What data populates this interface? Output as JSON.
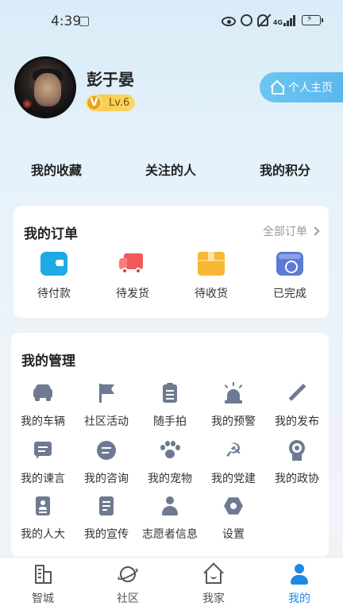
{
  "status_bar": {
    "time": "4:39",
    "network": "4G"
  },
  "profile": {
    "username": "彭于晏",
    "level_badge_letter": "V",
    "level": "Lv.6",
    "home_button_label": "个人主页"
  },
  "quick_links": [
    "我的收藏",
    "关注的人",
    "我的积分"
  ],
  "orders": {
    "title": "我的订单",
    "all_label": "全部订单",
    "items": [
      {
        "label": "待付款",
        "icon": "wallet-icon",
        "color": "#1fa9e5"
      },
      {
        "label": "待发货",
        "icon": "truck-icon",
        "color": "#f05a5a"
      },
      {
        "label": "待收货",
        "icon": "box-icon",
        "color": "#f7b733"
      },
      {
        "label": "已完成",
        "icon": "completed-icon",
        "color": "#5a7bd6"
      }
    ]
  },
  "management": {
    "title": "我的管理",
    "items": [
      {
        "label": "我的车辆",
        "icon": "car-icon"
      },
      {
        "label": "社区活动",
        "icon": "flag-icon"
      },
      {
        "label": "随手拍",
        "icon": "clipboard-icon"
      },
      {
        "label": "我的预警",
        "icon": "siren-icon"
      },
      {
        "label": "我的发布",
        "icon": "pencil-icon"
      },
      {
        "label": "我的谏言",
        "icon": "message-icon"
      },
      {
        "label": "我的咨询",
        "icon": "chat-bubble-icon"
      },
      {
        "label": "我的宠物",
        "icon": "paw-icon"
      },
      {
        "label": "我的党建",
        "icon": "party-emblem-icon"
      },
      {
        "label": "我的政协",
        "icon": "medal-icon"
      },
      {
        "label": "我的人大",
        "icon": "id-badge-icon"
      },
      {
        "label": "我的宣传",
        "icon": "document-icon"
      },
      {
        "label": "志愿者信息",
        "icon": "person-icon"
      },
      {
        "label": "设置",
        "icon": "settings-hex-icon"
      }
    ],
    "icon_color": "#6e7a91"
  },
  "bottom_nav": {
    "items": [
      {
        "label": "智城",
        "icon": "city-icon"
      },
      {
        "label": "社区",
        "icon": "planet-icon"
      },
      {
        "label": "我家",
        "icon": "house-icon"
      },
      {
        "label": "我的",
        "icon": "user-icon",
        "active": true
      }
    ],
    "active_color": "#1e88e5"
  },
  "colors": {
    "accent": "#5ab7ee",
    "badge_gold": "#f5c742"
  }
}
